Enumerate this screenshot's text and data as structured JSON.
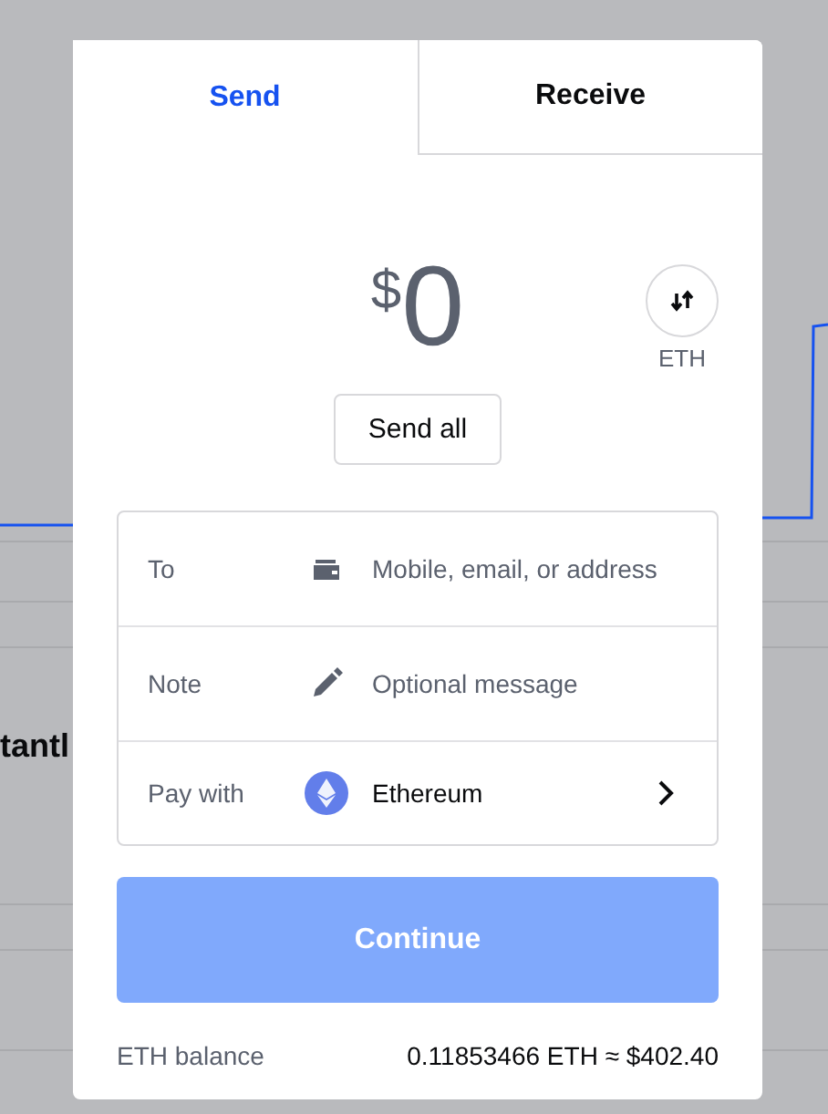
{
  "background": {
    "heading": "tantl"
  },
  "tabs": [
    {
      "label": "Send",
      "selected": true
    },
    {
      "label": "Receive",
      "selected": false
    }
  ],
  "amount": {
    "currency": "$",
    "value": "0"
  },
  "currency_toggle": {
    "label": "ETH"
  },
  "send_all_button": "Send all",
  "fields": [
    {
      "kind": "input",
      "label": "To",
      "placeholder": "Mobile, email, or address"
    },
    {
      "kind": "input",
      "label": "Note",
      "placeholder": "Optional message"
    },
    {
      "kind": "select",
      "label": "Pay with",
      "value": "Ethereum"
    }
  ],
  "continue_button": {
    "label": "Continue",
    "disabled": true
  },
  "balance": {
    "label": "ETH balance",
    "value": "0.11853466 ETH ≈ $402.40"
  }
}
